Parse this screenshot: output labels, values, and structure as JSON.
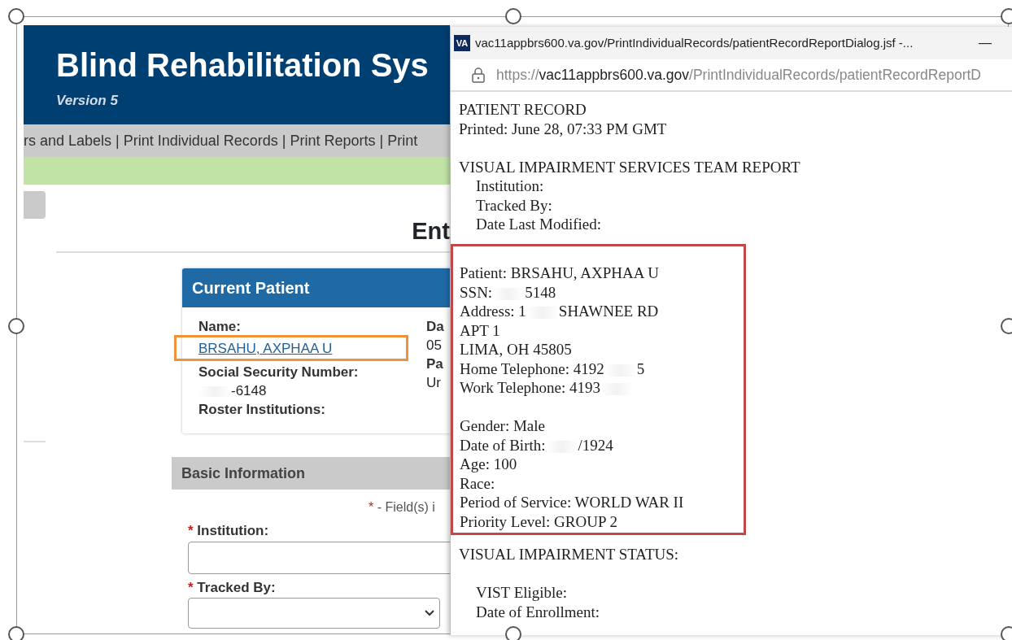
{
  "app": {
    "title": "Blind Rehabilitation Sys",
    "version": "Version 5",
    "nav": "rs and Labels | Print Individual Records | Print Reports | Print",
    "page_heading": "Ent",
    "current_patient": {
      "title": "Current Patient",
      "fields": [
        {
          "label": "Name:",
          "kind": "link",
          "value": "BRSAHU, AXPHAA U",
          "highlighted": true
        },
        {
          "label": "Social Security Number:",
          "kind": "redacted",
          "value": "-6148"
        },
        {
          "label": "Roster Institutions:",
          "kind": "empty"
        }
      ],
      "column_2": [
        {
          "label": "Da",
          "value": "05"
        },
        {
          "label": "Pa",
          "value": "Ur"
        }
      ]
    },
    "basic_information": {
      "title": "Basic Information",
      "required_mark": "*",
      "required_note": "- Field(s) i",
      "fields": [
        {
          "label": "Institution:",
          "required": true,
          "kind": "input"
        },
        {
          "label": "Tracked By:",
          "required": true,
          "kind": "select"
        }
      ]
    }
  },
  "popup": {
    "icon_text": "VA",
    "title": "vac11appbrs600.va.gov/PrintIndividualRecords/patientRecordReportDialog.jsf -...",
    "minimize": "—",
    "url_scheme": "https://",
    "url_host": "vac11appbrs600.va.gov",
    "url_path": "/PrintIndividualRecords/patientRecordReportD",
    "report": [
      {
        "kind": "block",
        "groups": [
          [
            {
              "text": "PATIENT RECORD"
            },
            {
              "text": "Printed: June 28, 07:33 PM GMT"
            }
          ]
        ]
      },
      {
        "kind": "block",
        "groups": [
          [
            {
              "text": "VISUAL IMPAIRMENT SERVICES TEAM REPORT",
              "spaced": false,
              "children": [
                {
                  "text": "Institution:"
                },
                {
                  "text": "Tracked By:"
                },
                {
                  "text": "Date Last Modified:"
                }
              ]
            }
          ]
        ]
      },
      {
        "kind": "boxed",
        "groups": [
          [
            {
              "text": "Patient: BRSAHU, AXPHAA U"
            },
            {
              "segments": [
                {
                  "kind": "text",
                  "text": "SSN:"
                },
                {
                  "kind": "redaction"
                },
                {
                  "kind": "text",
                  "text": "5148"
                }
              ]
            },
            {
              "segments": [
                {
                  "kind": "text",
                  "text": "Address: 1"
                },
                {
                  "kind": "redaction"
                },
                {
                  "kind": "text",
                  "text": "SHAWNEE RD"
                }
              ]
            },
            {
              "text": "APT 1"
            },
            {
              "text": "LIMA, OH 45805"
            },
            {
              "segments": [
                {
                  "kind": "text",
                  "text": "Home Telephone: 4192"
                },
                {
                  "kind": "redaction"
                },
                {
                  "kind": "text",
                  "text": "5"
                }
              ]
            },
            {
              "segments": [
                {
                  "kind": "text",
                  "text": "Work Telephone: 4193"
                },
                {
                  "kind": "redaction"
                }
              ]
            }
          ],
          [
            {
              "text": "Gender: Male"
            },
            {
              "segments": [
                {
                  "kind": "text",
                  "text": "Date of Birth:"
                },
                {
                  "kind": "redaction"
                },
                {
                  "kind": "text",
                  "text": "/1924"
                }
              ]
            },
            {
              "text": "Age: 100"
            },
            {
              "text": "Race:"
            },
            {
              "text": "Period of Service: WORLD WAR II"
            },
            {
              "text": "Priority Level: GROUP 2"
            }
          ]
        ]
      },
      {
        "kind": "block",
        "groups": [
          [
            {
              "text": "VISUAL IMPAIRMENT STATUS:",
              "spaced": true,
              "children": [
                {
                  "text": "VIST Eligible:"
                },
                {
                  "text": "Date of Enrollment:"
                }
              ]
            }
          ]
        ]
      }
    ]
  }
}
